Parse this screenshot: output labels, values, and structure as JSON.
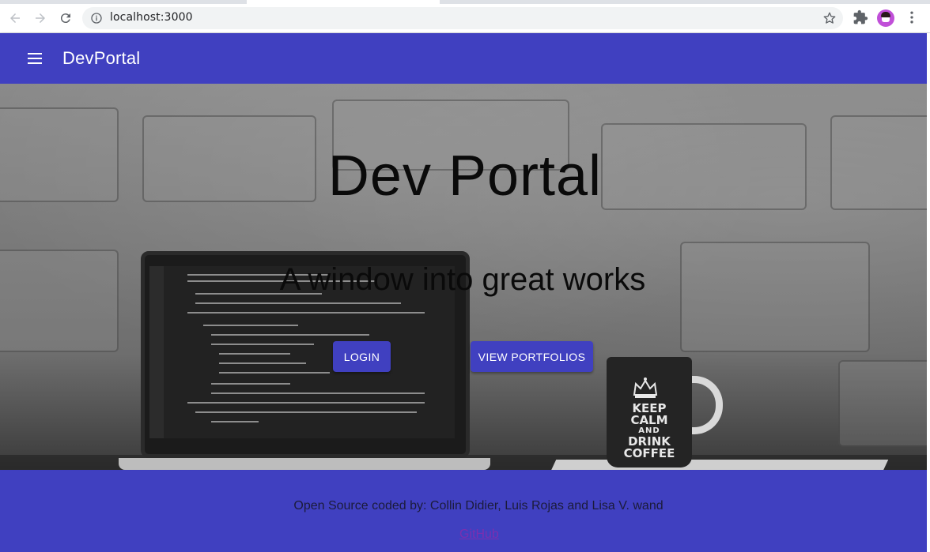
{
  "browser": {
    "url": "localhost:3000",
    "icons": {
      "back": "arrow-left-icon",
      "forward": "arrow-right-icon",
      "reload": "reload-icon",
      "site_info": "info-icon",
      "bookmark": "star-icon",
      "extensions": "puzzle-icon",
      "profile": "avatar",
      "menu": "more-vert-icon"
    }
  },
  "appbar": {
    "title": "DevPortal",
    "menu_icon": "hamburger-icon",
    "color": "#4040c0"
  },
  "hero": {
    "title": "Dev Portal",
    "subtitle": "A window into great works",
    "buttons": {
      "login": "LOGIN",
      "view_portfolios": "VIEW PORTFOLIOS"
    },
    "mug_text": {
      "line1": "KEEP",
      "line2": "CALM",
      "line3": "AND",
      "line4": "DRINK",
      "line5": "COFFEE"
    }
  },
  "footer": {
    "credits": "Open Source coded by: Collin Didier, Luis Rojas and Lisa V. wand",
    "link": "GitHub"
  }
}
